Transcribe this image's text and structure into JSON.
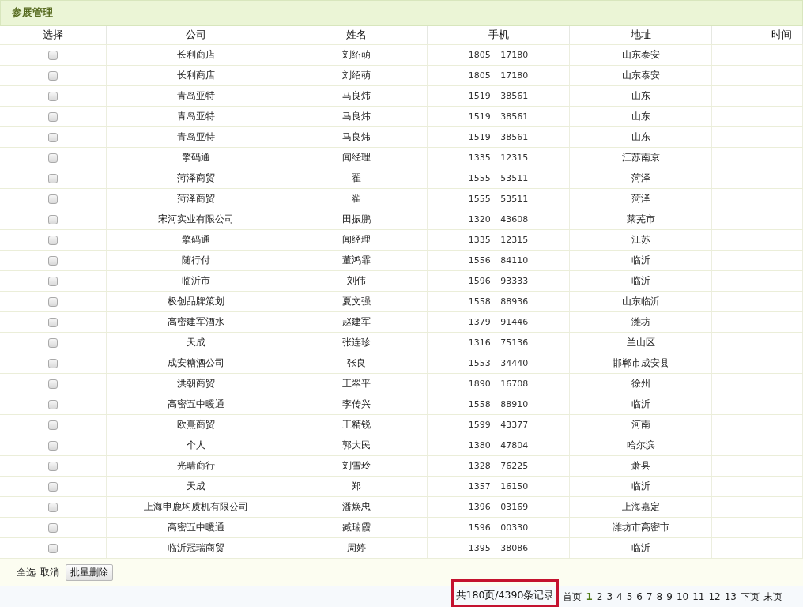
{
  "panel": {
    "title": "参展管理"
  },
  "table": {
    "columns": [
      "选择",
      "公司",
      "姓名",
      "手机",
      "地址",
      "时间"
    ],
    "rows": [
      {
        "checked": false,
        "company": "长利商店",
        "name": "刘绍萌",
        "phone": "1805 17180",
        "address": "山东泰安"
      },
      {
        "checked": false,
        "company": "长利商店",
        "name": "刘绍萌",
        "phone": "1805 17180",
        "address": "山东泰安"
      },
      {
        "checked": false,
        "company": "青岛亚特",
        "name": "马良炜",
        "phone": "1519 38561",
        "address": "山东"
      },
      {
        "checked": false,
        "company": "青岛亚特",
        "name": "马良炜",
        "phone": "1519 38561",
        "address": "山东"
      },
      {
        "checked": false,
        "company": "青岛亚特",
        "name": "马良炜",
        "phone": "1519 38561",
        "address": "山东"
      },
      {
        "checked": false,
        "company": "擎码通",
        "name": "闻经理",
        "phone": "1335 12315",
        "address": "江苏南京"
      },
      {
        "checked": false,
        "company": "菏泽商贸",
        "name": "翟",
        "phone": "1555 53511",
        "address": "菏泽"
      },
      {
        "checked": false,
        "company": "菏泽商贸",
        "name": "翟",
        "phone": "1555 53511",
        "address": "菏泽"
      },
      {
        "checked": false,
        "company": "宋河实业有限公司",
        "name": "田振鹏",
        "phone": "1320 43608",
        "address": "莱芜市"
      },
      {
        "checked": false,
        "company": "擎码通",
        "name": "闻经理",
        "phone": "1335 12315",
        "address": "江苏"
      },
      {
        "checked": false,
        "company": "随行付",
        "name": "董鸿霏",
        "phone": "1556 84110",
        "address": "临沂"
      },
      {
        "checked": false,
        "company": "临沂市",
        "name": "刘伟",
        "phone": "1596 93333",
        "address": "临沂"
      },
      {
        "checked": false,
        "company": "极创品牌策划",
        "name": "夏文强",
        "phone": "1558 88936",
        "address": "山东临沂"
      },
      {
        "checked": false,
        "company": "高密建军酒水",
        "name": "赵建军",
        "phone": "1379 91446",
        "address": "潍坊"
      },
      {
        "checked": false,
        "company": "天成",
        "name": "张连珍",
        "phone": "1316 75136",
        "address": "兰山区"
      },
      {
        "checked": false,
        "company": "成安糖酒公司",
        "name": "张良",
        "phone": "1553 34440",
        "address": "邯郸市成安县"
      },
      {
        "checked": false,
        "company": "洪朝商贸",
        "name": "王翠平",
        "phone": "1890 16708",
        "address": "徐州"
      },
      {
        "checked": false,
        "company": "高密五中暖通",
        "name": "李传兴",
        "phone": "1558 88910",
        "address": "临沂"
      },
      {
        "checked": false,
        "company": "欧熹商贸",
        "name": "王精锐",
        "phone": "1599 43377",
        "address": "河南"
      },
      {
        "checked": false,
        "company": "个人",
        "name": "郭大民",
        "phone": "1380 47804",
        "address": "哈尔滨"
      },
      {
        "checked": false,
        "company": "光晴商行",
        "name": "刘雪玲",
        "phone": "1328 76225",
        "address": "萧县"
      },
      {
        "checked": false,
        "company": "天成",
        "name": "郑",
        "phone": "1357 16150",
        "address": "临沂"
      },
      {
        "checked": false,
        "company": "上海申鹿均质机有限公司",
        "name": "潘焕忠",
        "phone": "1396 03169",
        "address": "上海嘉定"
      },
      {
        "checked": false,
        "company": "高密五中暖通",
        "name": "臧瑞霞",
        "phone": "1596 00330",
        "address": "潍坊市高密市"
      },
      {
        "checked": false,
        "company": "临沂冠瑞商贸",
        "name": "周婷",
        "phone": "1395 38086",
        "address": "临沂"
      }
    ]
  },
  "actions": {
    "select_all": "全选",
    "cancel": "取消",
    "batch_delete": "批量删除"
  },
  "pagination": {
    "summary": "共180页/4390条记录",
    "highlighted": true,
    "first": "首页",
    "pages": [
      {
        "label": "1",
        "selected": true
      },
      {
        "label": "2",
        "selected": false
      },
      {
        "label": "3",
        "selected": false
      },
      {
        "label": "4",
        "selected": false
      },
      {
        "label": "5",
        "selected": false
      },
      {
        "label": "6",
        "selected": false
      },
      {
        "label": "7",
        "selected": false
      },
      {
        "label": "8",
        "selected": false
      },
      {
        "label": "9",
        "selected": false
      },
      {
        "label": "10",
        "selected": false
      },
      {
        "label": "11",
        "selected": false
      },
      {
        "label": "12",
        "selected": false
      },
      {
        "label": "13",
        "selected": false
      }
    ],
    "next": "下页",
    "last": "末页"
  }
}
